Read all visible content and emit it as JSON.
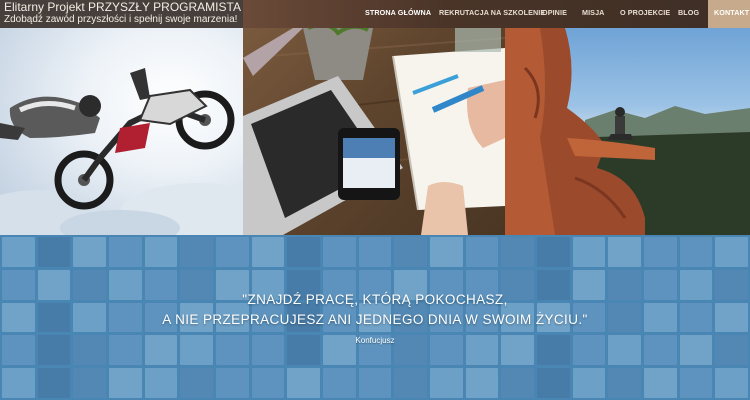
{
  "brand": {
    "title": "Elitarny Projekt PRZYSZŁY PROGRAMISTA",
    "tagline": "Zdobądź zawód przyszłości i spełnij swoje marzenia!"
  },
  "nav": {
    "items": [
      {
        "label": "STRONA GŁÓWNA",
        "state": "active"
      },
      {
        "label": "REKRUTACJA NA SZKOLENIE",
        "state": "normal"
      },
      {
        "label": "OPINIE",
        "state": "normal"
      },
      {
        "label": "MISJA",
        "state": "normal"
      },
      {
        "label": "O PROJEKCIE",
        "state": "normal"
      },
      {
        "label": "BLOG",
        "state": "normal"
      },
      {
        "label": "KONTAKT",
        "state": "highlight"
      }
    ]
  },
  "hero": {
    "panels": [
      {
        "name": "motocross-rider-in-sky",
        "icon": "photo-icon"
      },
      {
        "name": "laptop-smartphone-notebook-desk",
        "icon": "photo-icon"
      },
      {
        "name": "meditating-person-on-cliff",
        "icon": "photo-icon"
      }
    ]
  },
  "quote": {
    "line1": "\"ZNAJDŹ PRACĘ, KTÓRĄ POKOCHASZ,",
    "line2": "A NIE PRZEPRACUJESZ ANI JEDNEGO DNIA W SWOIM ŻYCIU.\"",
    "author": "Konfucjusz"
  },
  "colors": {
    "nav_bg": "#4a3428",
    "nav_highlight": "#c7a98c",
    "quote_bg": "#4f8cb8",
    "text_light": "#ffffff"
  }
}
